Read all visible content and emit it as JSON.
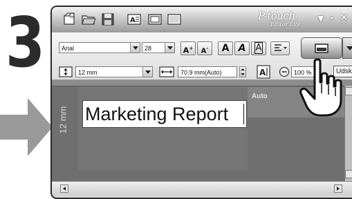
{
  "step": {
    "number": "3"
  },
  "app": {
    "logo_script": "P-touch",
    "logo_sub": "Editor Lite"
  },
  "window_controls": {
    "minimize": "-",
    "close": "×",
    "menu": "▾"
  },
  "toolbar": {
    "font_name": "Arial",
    "font_size": "28",
    "format_buttons": [
      "A",
      "A",
      "A",
      "A",
      "A"
    ],
    "tape_width": "12 mm",
    "label_length": "70.9 mm(Auto)",
    "zoom": "100 %",
    "print_label": "Udskriv"
  },
  "canvas": {
    "tape_length_label": "12 mm",
    "auto_label": "Auto",
    "text_value": "Marketing Report"
  },
  "colors": {
    "accent": "#2b2b2b",
    "canvas": "#6f6f6f"
  }
}
